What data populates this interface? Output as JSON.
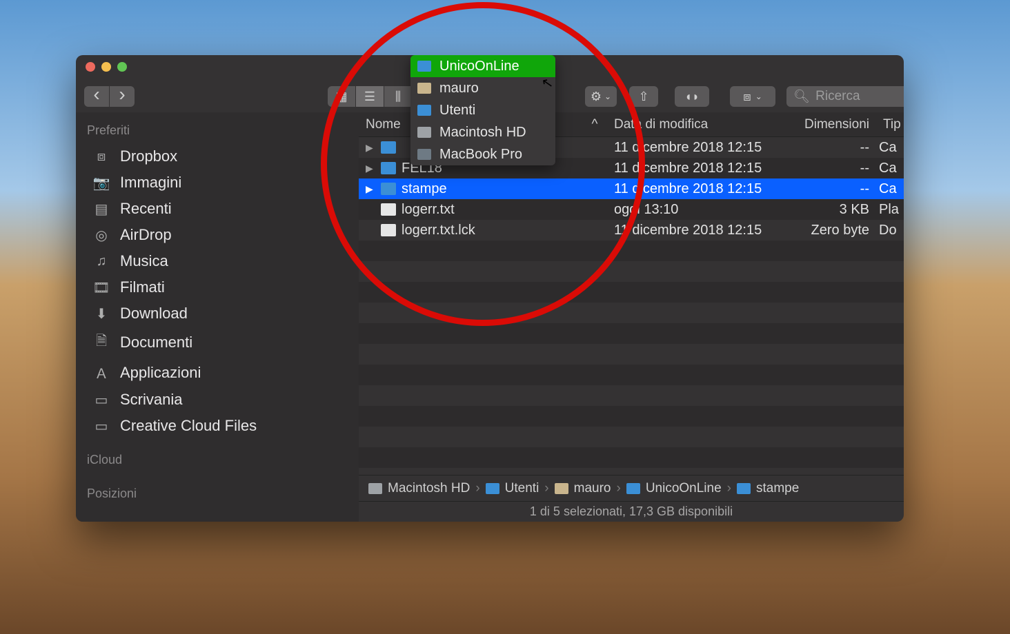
{
  "search_placeholder": "Ricerca",
  "sidebar": {
    "section_fav": "Preferiti",
    "section_icloud": "iCloud",
    "section_pos": "Posizioni",
    "items": [
      {
        "icon": "⧈",
        "label": "Dropbox"
      },
      {
        "icon": "📷",
        "label": "Immagini"
      },
      {
        "icon": "▤",
        "label": "Recenti"
      },
      {
        "icon": "◎",
        "label": "AirDrop"
      },
      {
        "icon": "♫",
        "label": "Musica"
      },
      {
        "icon": "🎞",
        "label": "Filmati"
      },
      {
        "icon": "⬇",
        "label": "Download"
      },
      {
        "icon": "🗎",
        "label": "Documenti"
      },
      {
        "icon": "Ａ",
        "label": "Applicazioni"
      },
      {
        "icon": "▭",
        "label": "Scrivania"
      },
      {
        "icon": "▭",
        "label": "Creative Cloud Files"
      }
    ]
  },
  "columns": {
    "name": "Nome",
    "date": "Data di modifica",
    "size": "Dimensioni",
    "kind": "Tip"
  },
  "rows": [
    {
      "type": "folder",
      "name": "",
      "date": "11 dicembre 2018 12:15",
      "size": "--",
      "kind": "Ca",
      "selected": false
    },
    {
      "type": "folder",
      "name": "FEL18",
      "date": "11 dicembre 2018 12:15",
      "size": "--",
      "kind": "Ca",
      "selected": false
    },
    {
      "type": "folder",
      "name": "stampe",
      "date": "11 dicembre 2018 12:15",
      "size": "--",
      "kind": "Ca",
      "selected": true
    },
    {
      "type": "file",
      "name": "logerr.txt",
      "date": "oggi 13:10",
      "size": "3 KB",
      "kind": "Pla",
      "selected": false
    },
    {
      "type": "file",
      "name": "logerr.txt.lck",
      "date": "11 dicembre 2018 12:15",
      "size": "Zero byte",
      "kind": "Do",
      "selected": false
    }
  ],
  "pathmenu": [
    {
      "label": "UnicoOnLine",
      "icon": "folder",
      "hi": true
    },
    {
      "label": "mauro",
      "icon": "home"
    },
    {
      "label": "Utenti",
      "icon": "folder"
    },
    {
      "label": "Macintosh HD",
      "icon": "disk"
    },
    {
      "label": "MacBook Pro",
      "icon": "comp"
    }
  ],
  "pathbar": [
    "Macintosh HD",
    "Utenti",
    "mauro",
    "UnicoOnLine",
    "stampe"
  ],
  "status": "1 di 5 selezionati, 17,3 GB disponibili"
}
